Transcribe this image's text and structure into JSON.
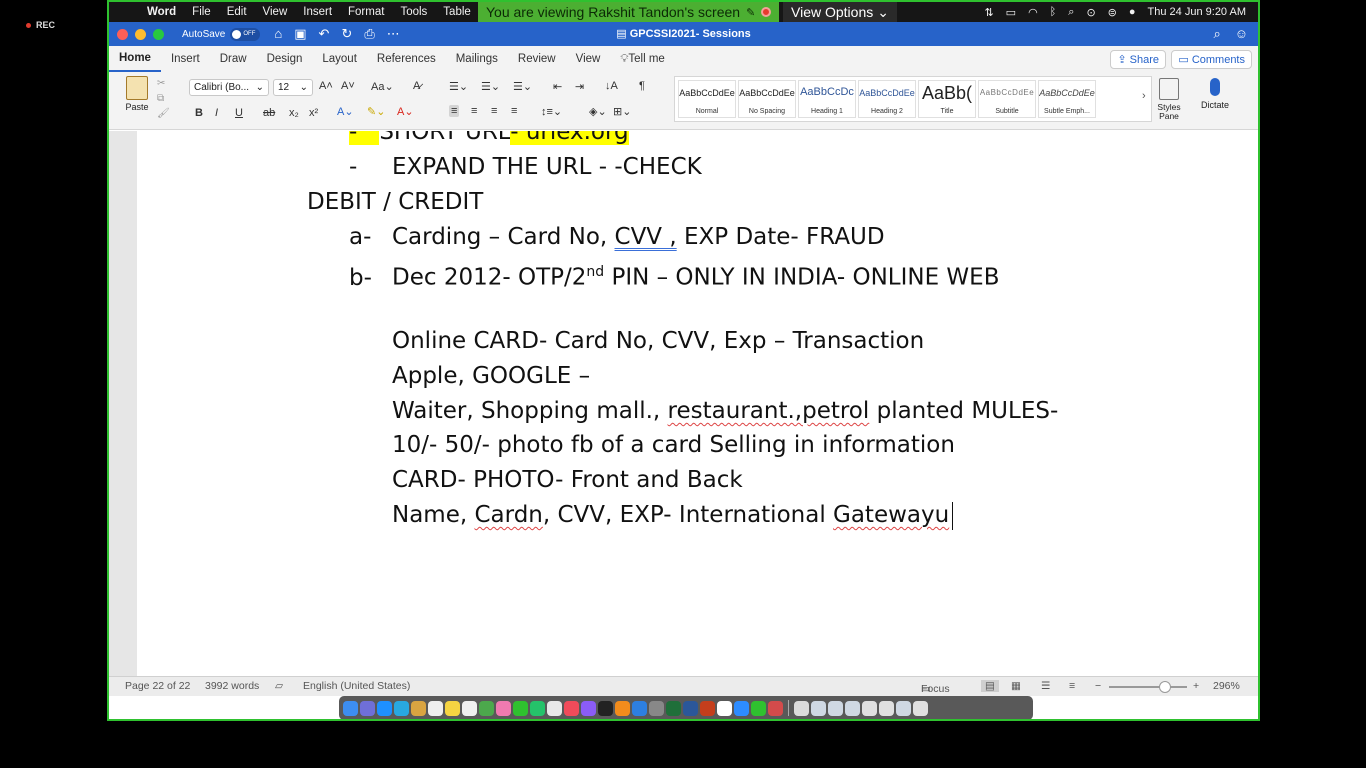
{
  "recording": {
    "label": "REC"
  },
  "menubar": {
    "items": [
      "Word",
      "File",
      "Edit",
      "View",
      "Insert",
      "Format",
      "Tools",
      "Table"
    ],
    "share_banner": "You are viewing Rakshit Tandon's screen",
    "view_options": "View Options",
    "clock": "Thu 24 Jun  9:20 AM"
  },
  "titlebar": {
    "autosave_label": "AutoSave",
    "autosave_state": "OFF",
    "document_title": "GPCSSI2021- Sessions"
  },
  "ribbon": {
    "tabs": [
      "Home",
      "Insert",
      "Draw",
      "Design",
      "Layout",
      "References",
      "Mailings",
      "Review",
      "View",
      "Tell me"
    ],
    "share_label": "Share",
    "comments_label": "Comments",
    "paste_label": "Paste",
    "font_name": "Calibri (Bo...",
    "font_size": "12",
    "styles": [
      {
        "preview": "AaBbCcDdEe",
        "name": "Normal"
      },
      {
        "preview": "AaBbCcDdEe",
        "name": "No Spacing"
      },
      {
        "preview": "AaBbCcDc",
        "name": "Heading 1"
      },
      {
        "preview": "AaBbCcDdEe",
        "name": "Heading 2"
      },
      {
        "preview": "AaBb(",
        "name": "Title"
      },
      {
        "preview": "AaBbCcDdEe",
        "name": "Subtitle"
      },
      {
        "preview": "AaBbCcDdEe",
        "name": "Subtle Emph..."
      }
    ],
    "styles_pane_label": "Styles Pane",
    "dictate_label": "Dictate"
  },
  "document": {
    "l1": {
      "bullet": "-",
      "pre": "SHORT URL",
      "hl": "- urlex.org"
    },
    "l2": {
      "bullet": "-",
      "text": "EXPAND THE URL - -CHECK"
    },
    "l3": {
      "text": "DEBIT / CREDIT"
    },
    "l4": {
      "marker": "a-",
      "pre": "Carding – Card No, ",
      "cvv": "CVV ,",
      "post": " EXP Date- FRAUD"
    },
    "l5": {
      "marker": "b-",
      "pre": "Dec 2012- OTP/2",
      "sup": "nd",
      "post": " PIN – ONLY IN INDIA- ONLINE WEB"
    },
    "l6": {
      "text": "Online CARD- Card No, CVV, Exp – Transaction"
    },
    "l7": {
      "text": "Apple, GOOGLE –"
    },
    "l8": {
      "pre": "Waiter, Shopping mall., ",
      "spell": "restaurant.,petrol",
      "post": " planted MULES-"
    },
    "l9": {
      "text": "10/- 50/- photo fb of a card Selling in information"
    },
    "l10": {
      "text": "CARD- PHOTO- Front and Back"
    },
    "l11": {
      "pre": "Name, ",
      "w1": "Cardn",
      "mid": ", CVV, EXP- International ",
      "w2": "Gatewayu"
    }
  },
  "statusbar": {
    "page": "Page 22 of 22",
    "words": "3992 words",
    "language": "English (United States)",
    "focus": "Focus",
    "zoom": "296%"
  },
  "colors": {
    "frame_border": "#2fc12f",
    "word_blue": "#2763c9",
    "highlight": "#ffff00",
    "banner_green": "#4caf32"
  }
}
